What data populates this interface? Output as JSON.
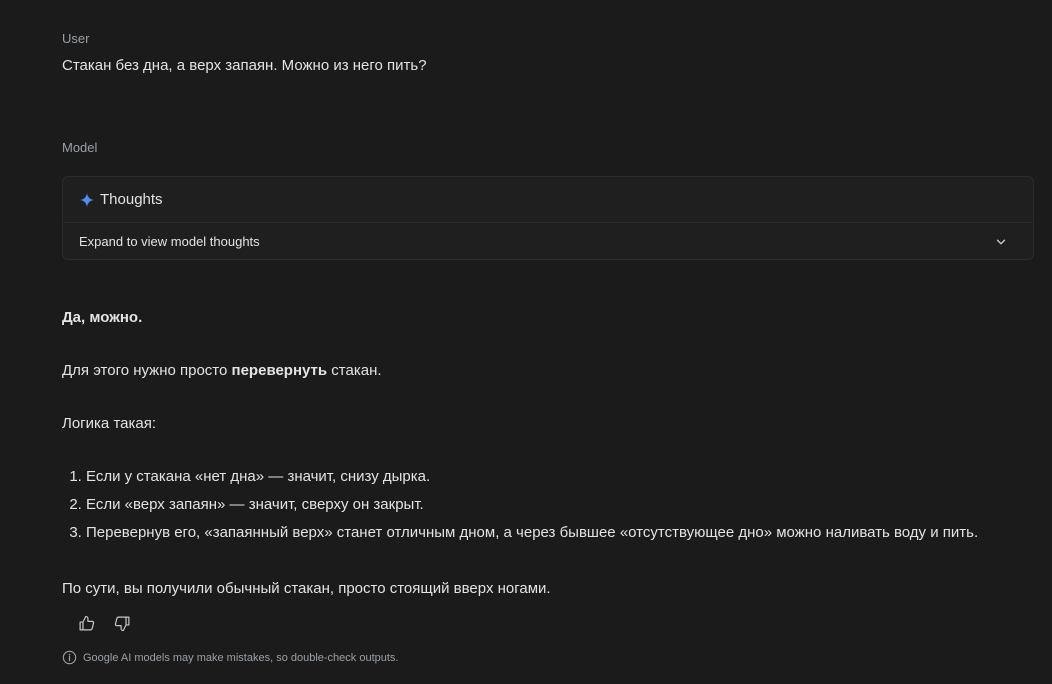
{
  "user": {
    "label": "User",
    "message": "Стакан без дна, а верх запаян. Можно из него пить?"
  },
  "model": {
    "label": "Model",
    "thoughts": {
      "title": "Thoughts",
      "expand_text": "Expand to view model thoughts",
      "icon": "sparkle-icon"
    },
    "answer": {
      "yes": "Да, можно.",
      "line1_before": "Для этого нужно просто ",
      "line1_bold": "перевернуть",
      "line1_after": " стакан.",
      "line2": "Логика такая:",
      "list": [
        "Если у стакана «нет дна» — значит, снизу дырка.",
        "Если «верх запаян» — значит, сверху он закрыт.",
        "Перевернув его, «запаянный верх» станет отличным дном, а через бывшее «отсутствующее дно» можно наливать воду и пить."
      ],
      "line3": "По сути, вы получили обычный стакан, просто стоящий вверх ногами."
    },
    "feedback": {
      "like_icon": "thumbs-up-icon",
      "dislike_icon": "thumbs-down-icon"
    }
  },
  "disclaimer": {
    "text": "Google AI models may make mistakes, so double-check outputs.",
    "icon": "info-icon"
  },
  "colors": {
    "background": "#1b1b1b",
    "text": "#e3e3e3",
    "muted": "#9aa0a6",
    "accent": "#4c8df6"
  }
}
